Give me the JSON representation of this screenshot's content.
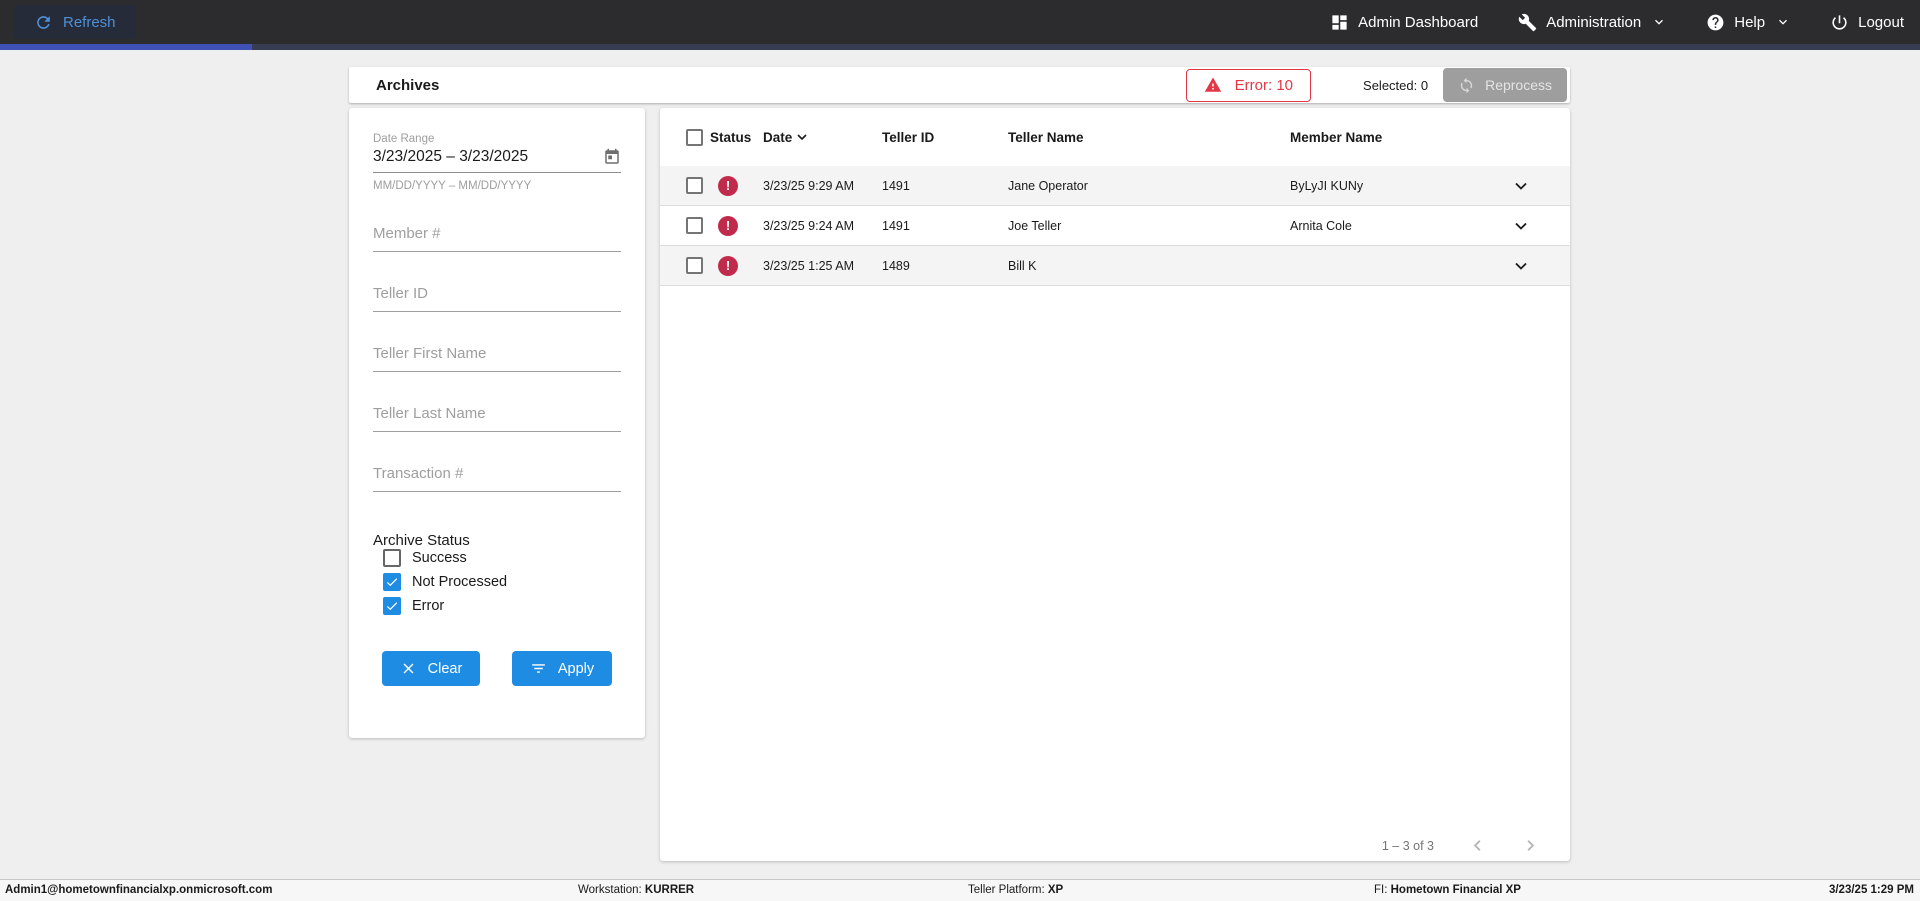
{
  "topbar": {
    "refresh_label": "Refresh",
    "nav": [
      {
        "label": "Admin Dashboard",
        "icon": "dashboard-icon",
        "has_caret": false
      },
      {
        "label": "Administration",
        "icon": "wrench-icon",
        "has_caret": true
      },
      {
        "label": "Help",
        "icon": "help-icon",
        "has_caret": true
      },
      {
        "label": "Logout",
        "icon": "power-icon",
        "has_caret": false
      }
    ]
  },
  "header": {
    "title": "Archives",
    "error_badge": "Error: 10",
    "selected_label": "Selected: 0",
    "reprocess_label": "Reprocess"
  },
  "filters": {
    "date_range": {
      "label": "Date Range",
      "value": "3/23/2025 – 3/23/2025",
      "hint": "MM/DD/YYYY – MM/DD/YYYY",
      "icon": "calendar-icon"
    },
    "fields": [
      {
        "placeholder": "Member #"
      },
      {
        "placeholder": "Teller ID"
      },
      {
        "placeholder": "Teller First Name"
      },
      {
        "placeholder": "Teller Last Name"
      },
      {
        "placeholder": "Transaction #"
      }
    ],
    "archive_status": {
      "label": "Archive Status",
      "options": [
        {
          "label": "Success",
          "checked": false
        },
        {
          "label": "Not Processed",
          "checked": true
        },
        {
          "label": "Error",
          "checked": true
        }
      ]
    },
    "clear_label": "Clear",
    "apply_label": "Apply"
  },
  "table": {
    "columns": [
      "Status",
      "Date",
      "Teller ID",
      "Teller Name",
      "Member Name"
    ],
    "sort_column": "Date",
    "sort_direction": "desc",
    "status_icon": "error-icon",
    "status_symbol": "!",
    "rows": [
      {
        "status": "error",
        "date": "3/23/25 9:29 AM",
        "teller_id": "1491",
        "teller_name": "Jane Operator",
        "member_name": "ByLyJI KUNy"
      },
      {
        "status": "error",
        "date": "3/23/25 9:24 AM",
        "teller_id": "1491",
        "teller_name": "Joe Teller",
        "member_name": "Arnita Cole"
      },
      {
        "status": "error",
        "date": "3/23/25 1:25 AM",
        "teller_id": "1489",
        "teller_name": "Bill K",
        "member_name": ""
      }
    ],
    "pagination": "1 – 3 of 3"
  },
  "footer": {
    "user": "Admin1@hometownfinancialxp.onmicrosoft.com",
    "workstation_label": "Workstation:",
    "workstation_value": "KURRER",
    "platform_label": "Teller Platform:",
    "platform_value": "XP",
    "fi_label": "FI:",
    "fi_value": "Hometown Financial XP",
    "datetime": "3/23/25 1:29 PM"
  },
  "colors": {
    "accent_blue": "#1f8ce3",
    "link_blue": "#4e90d9",
    "indicator_indigo": "#3f51b5",
    "error_red": "#e23744",
    "status_red": "#c12b4b",
    "topbar_bg": "#2c2c2f",
    "disabled_gray": "#9e9e9e"
  }
}
